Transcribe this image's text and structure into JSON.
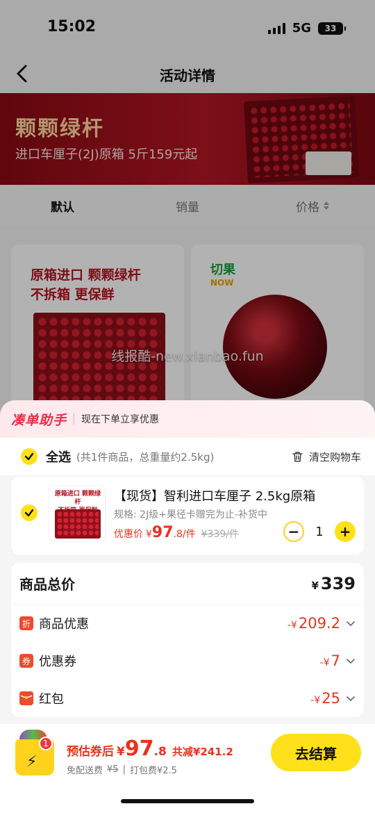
{
  "status_bar": {
    "time": "15:02",
    "network": "5G",
    "battery": "33"
  },
  "nav": {
    "title": "活动详情"
  },
  "banner": {
    "title": "颗颗绿杆",
    "subtitle": "进口车厘子(2J)原箱  5斤159元起"
  },
  "sort_tabs": [
    {
      "label": "默认"
    },
    {
      "label": "销量"
    },
    {
      "label": "价格"
    }
  ],
  "products": [
    {
      "headline_line1": "原箱进口 颗颗绿杆",
      "headline_line2": "不拆箱 更保鲜"
    },
    {
      "logo": "切果",
      "logo_sub": "NOW"
    }
  ],
  "watermark": "线报酷-new.xianbao.fun",
  "helper": {
    "logo": "凑单助手",
    "text": "现在下单立享优惠"
  },
  "select_all": {
    "label": "全选",
    "meta": "(共1件商品，总重量约2.5kg)",
    "clear": "清空购物车"
  },
  "item": {
    "thumb_line1": "原箱进口 颗颗绿杆",
    "thumb_line2": "不拆箱 更保鲜",
    "title": "【现货】智利进口车厘子 2.5kg原箱",
    "spec": "规格: 2J级+果径卡赠完为止-补货中",
    "price_label": "优惠价",
    "price_currency": "¥",
    "price_int": "97",
    "price_dec": ".8/件",
    "orig_price": "¥339/件",
    "qty": "1",
    "minus": "−",
    "plus": "+"
  },
  "summary": {
    "total_label": "商品总价",
    "total_currency": "¥",
    "total_value": "339",
    "rows": [
      {
        "icon": "折",
        "label": "商品优惠",
        "prefix": "-¥",
        "value": "209.2"
      },
      {
        "icon": "券",
        "label": "优惠券",
        "prefix": "-¥",
        "value": "7"
      },
      {
        "icon": "",
        "label": "红包",
        "prefix": "-¥",
        "value": "25"
      }
    ]
  },
  "footer": {
    "badge": "1",
    "est_label": "预估券后",
    "est_currency": "¥",
    "est_int": "97",
    "est_dec": ".8",
    "save_text": "共减¥241.2",
    "fee_free": "免配送费",
    "fee_orig": "¥5",
    "fee_sep": "|",
    "fee_pack": "打包费¥2.5",
    "checkout": "去结算"
  },
  "colors": {
    "accent_yellow": "#ffe01b",
    "price_red": "#e8331e",
    "helper_red": "#e82d45"
  }
}
